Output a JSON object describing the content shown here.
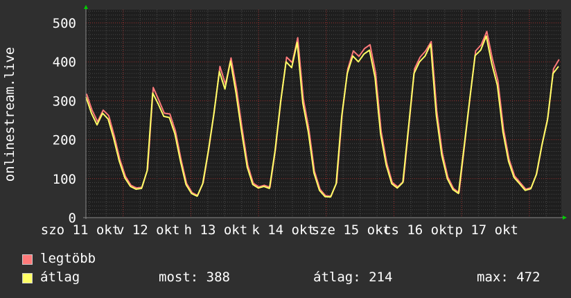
{
  "chart_data": {
    "type": "line",
    "title": "",
    "ylabel": "onlinestream.live",
    "xlabel": "",
    "ylim": [
      0,
      540
    ],
    "yticks": [
      "0",
      "100",
      "200",
      "300",
      "400",
      "500"
    ],
    "xtick_labels": [
      "szo 11 okt",
      "v 12 okt",
      "h 13 okt",
      "k 14 okt",
      "sze 15 okt",
      "cs 16 okt",
      "p 17 okt"
    ],
    "grid": true,
    "legend_placement": "bottom",
    "series": [
      {
        "name": "legtöbb",
        "color": "#ff7a7a",
        "values": [
          318,
          276,
          246,
          276,
          262,
          210,
          150,
          106,
          83,
          76,
          78,
          125,
          334,
          302,
          268,
          266,
          222,
          150,
          88,
          64,
          57,
          90,
          176,
          274,
          388,
          342,
          410,
          330,
          228,
          135,
          88,
          79,
          83,
          78,
          176,
          305,
          412,
          398,
          462,
          305,
          228,
          119,
          73,
          56,
          55,
          90,
          268,
          382,
          428,
          414,
          434,
          444,
          372,
          222,
          140,
          90,
          79,
          93,
          238,
          382,
          412,
          428,
          452,
          274,
          166,
          104,
          75,
          64,
          186,
          310,
          428,
          444,
          478,
          408,
          352,
          228,
          150,
          107,
          90,
          73,
          77,
          114,
          192,
          259,
          382,
          406
        ]
      },
      {
        "name": "átlag",
        "color": "#ffff66",
        "values": [
          310,
          268,
          238,
          268,
          253,
          203,
          145,
          102,
          80,
          73,
          75,
          120,
          320,
          292,
          260,
          257,
          215,
          145,
          85,
          62,
          55,
          87,
          170,
          265,
          375,
          330,
          402,
          320,
          220,
          130,
          85,
          76,
          80,
          75,
          170,
          295,
          400,
          385,
          450,
          295,
          220,
          115,
          70,
          54,
          53,
          87,
          260,
          370,
          415,
          400,
          420,
          430,
          360,
          215,
          135,
          87,
          76,
          90,
          230,
          370,
          400,
          415,
          445,
          265,
          160,
          100,
          72,
          62,
          180,
          300,
          416,
          430,
          466,
          395,
          340,
          220,
          145,
          103,
          87,
          70,
          74,
          110,
          185,
          250,
          370,
          388
        ]
      }
    ]
  },
  "legend": {
    "max_label": "legtöbb",
    "avg_label": "átlag",
    "current": "most: 388",
    "average": "átlag: 214",
    "maximum": "max: 472"
  },
  "colors": {
    "background": "#2f2f2f",
    "plot_background": "#1e1e1e",
    "grid_major": "#a03030",
    "grid_minor": "#555555",
    "axis_arrow": "#00cc00"
  }
}
